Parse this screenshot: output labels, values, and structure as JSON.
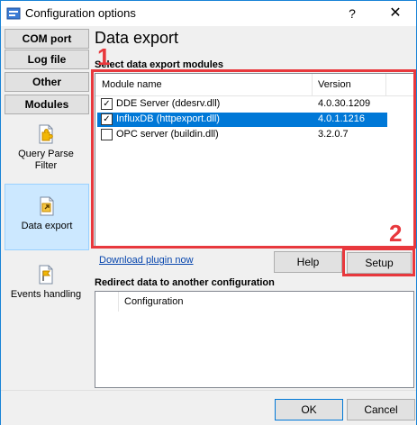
{
  "window": {
    "title": "Configuration options",
    "help_glyph": "?",
    "close_glyph": "✕"
  },
  "sidebar": {
    "tabs": [
      {
        "label": "COM port"
      },
      {
        "label": "Log file"
      },
      {
        "label": "Other"
      },
      {
        "label": "Modules"
      }
    ],
    "items": [
      {
        "label1": "Query Parse",
        "label2": "Filter"
      },
      {
        "label1": "Data export"
      },
      {
        "label1": "Events handling"
      }
    ]
  },
  "main": {
    "title": "Data export",
    "group_label": "Select data export modules",
    "columns": [
      "Module name",
      "Version"
    ],
    "modules": [
      {
        "name": "DDE Server (ddesrv.dll)",
        "version": "4.0.30.1209",
        "checked": true,
        "check_glyph": "✓"
      },
      {
        "name": "InfluxDB (httpexport.dll)",
        "version": "4.0.1.1216",
        "checked": true,
        "check_glyph": "✓"
      },
      {
        "name": "OPC server (buildin.dll)",
        "version": "3.2.0.7",
        "checked": false,
        "check_glyph": ""
      }
    ],
    "download_link": "Download plugin now",
    "help_button": "Help",
    "setup_button": "Setup",
    "redirect_label": "Redirect data to another configuration",
    "redirect_column": "Configuration"
  },
  "annotations": {
    "badge1": "1",
    "badge2": "2",
    "color": "#e8383d"
  },
  "footer": {
    "ok_button": "OK",
    "cancel_button": "Cancel"
  }
}
